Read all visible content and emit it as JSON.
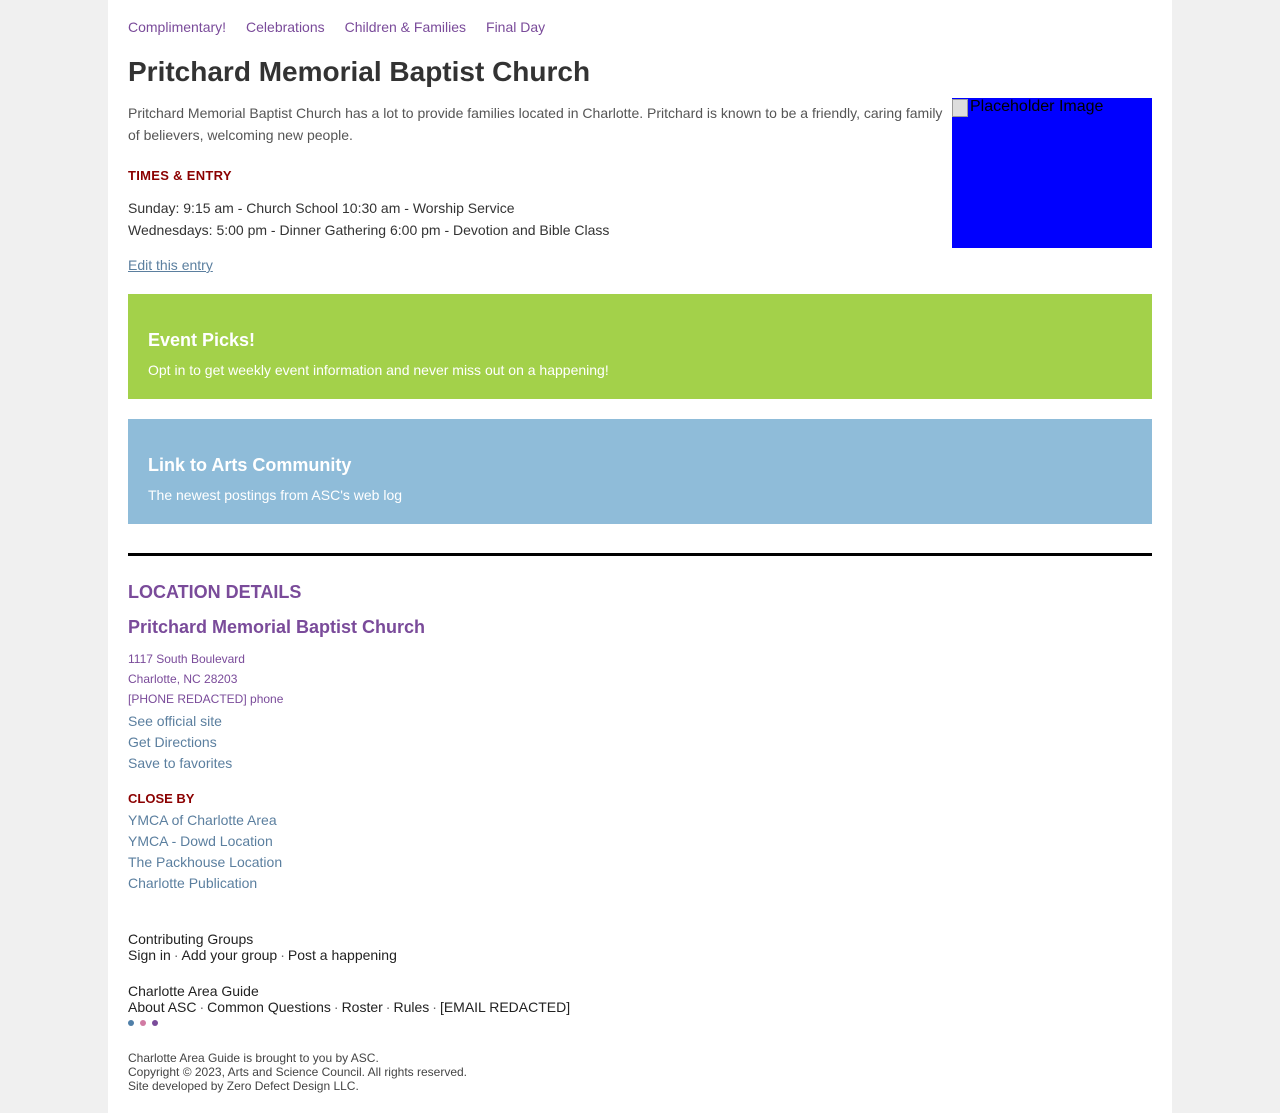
{
  "nav": {
    "items": [
      "Complimentary!",
      "Celebrations",
      "Children & Families",
      "Final Day"
    ]
  },
  "page": {
    "title": "Pritchard Memorial Baptist Church",
    "intro": "Pritchard Memorial Baptist Church has a lot to provide families located in Charlotte. Pritchard is known to be a friendly, caring family of believers, welcoming new people.",
    "image_alt": "Placeholder Image",
    "image_color": "#0000ff"
  },
  "times": {
    "heading": "TIMES & ENTRY",
    "lines": [
      "Sunday: 9:15 am - Church School 10:30 am - Worship Service",
      "Wednesdays: 5:00 pm - Dinner Gathering 6:00 pm - Devotion and Bible Class"
    ]
  },
  "edit_link": "Edit this entry",
  "promos": [
    {
      "title": "Event Picks!",
      "text": "Opt in to get weekly event information and never miss out on a happening!",
      "color": "#a3d14a"
    },
    {
      "title": "Link to Arts Community",
      "text": "The newest postings from ASC's web log",
      "color": "#8fbcd9"
    }
  ],
  "location": {
    "heading": "LOCATION DETAILS",
    "name": "Pritchard Memorial Baptist Church",
    "address_lines": [
      "1117 South Boulevard",
      "Charlotte, NC 28203",
      "[PHONE REDACTED] phone"
    ],
    "links": [
      "See official site",
      "Get Directions",
      "Save to favorites"
    ]
  },
  "close_by": {
    "heading": "CLOSE BY",
    "items": [
      "YMCA of Charlotte Area",
      "YMCA - Dowd Location",
      "The Packhouse Location",
      "Charlotte Publication"
    ]
  },
  "footer": {
    "groups_title": "Contributing Groups",
    "groups_links": [
      "Sign in",
      "Add your group",
      "Post a happening"
    ],
    "guide_title": "Charlotte Area Guide",
    "guide_links": [
      "About ASC",
      "Common Questions",
      "Roster",
      "Rules",
      "[EMAIL REDACTED]"
    ],
    "separator": "·",
    "dot_colors": [
      "#4f7fa8",
      "#d17aa3",
      "#7a4b9a"
    ],
    "legal": [
      "Charlotte Area Guide is brought to you by ASC.",
      "Copyright © 2023, Arts and Science Council. All rights reserved.",
      "Site developed by Zero Defect Design LLC."
    ]
  }
}
